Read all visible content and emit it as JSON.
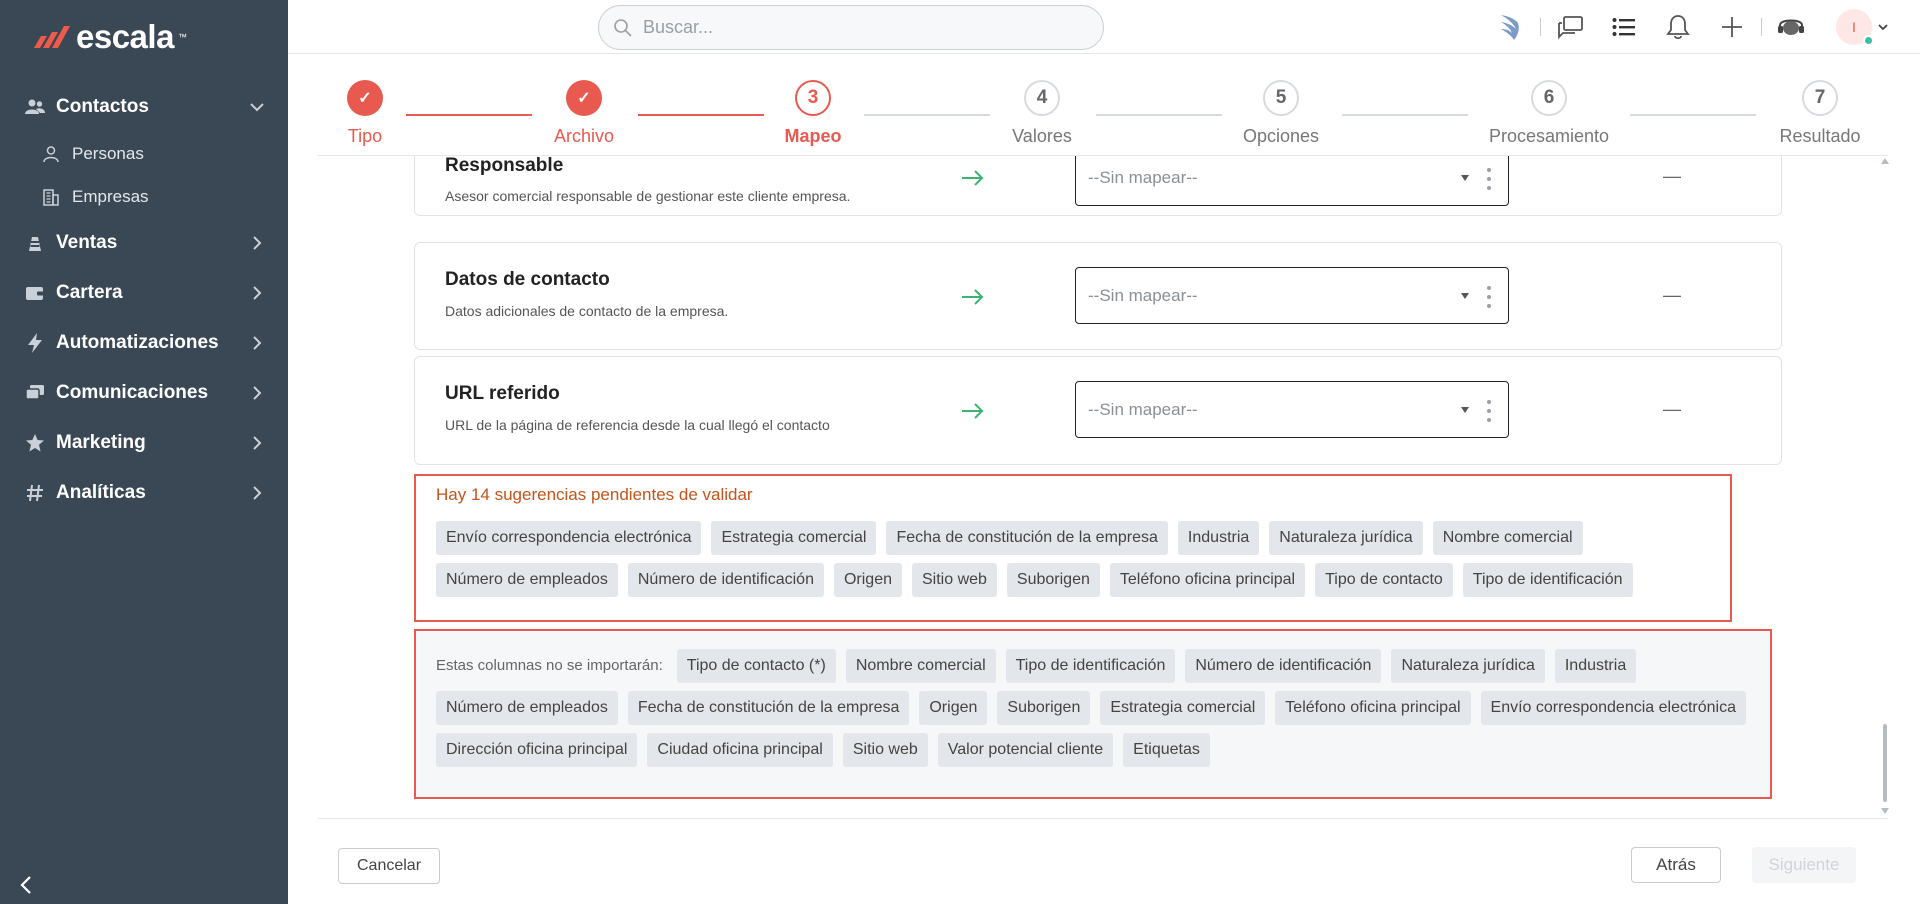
{
  "app": {
    "logo_text": "escala",
    "logo_tm": "™"
  },
  "sidebar": {
    "items": [
      {
        "label": "Contactos",
        "icon": "users-icon",
        "expanded": true,
        "children": [
          {
            "label": "Personas",
            "icon": "person-icon"
          },
          {
            "label": "Empresas",
            "icon": "building-icon"
          }
        ]
      },
      {
        "label": "Ventas",
        "icon": "ventas-icon"
      },
      {
        "label": "Cartera",
        "icon": "wallet-icon"
      },
      {
        "label": "Automatizaciones",
        "icon": "bolt-icon"
      },
      {
        "label": "Comunicaciones",
        "icon": "chat-icon"
      },
      {
        "label": "Marketing",
        "icon": "star-icon"
      },
      {
        "label": "Analíticas",
        "icon": "hash-icon"
      }
    ]
  },
  "header": {
    "search_placeholder": "Buscar...",
    "avatar_initial": "I"
  },
  "stepper": {
    "steps": [
      {
        "num": "1",
        "label": "Tipo",
        "state": "done"
      },
      {
        "num": "2",
        "label": "Archivo",
        "state": "done"
      },
      {
        "num": "3",
        "label": "Mapeo",
        "state": "active"
      },
      {
        "num": "4",
        "label": "Valores",
        "state": "todo"
      },
      {
        "num": "5",
        "label": "Opciones",
        "state": "todo"
      },
      {
        "num": "6",
        "label": "Procesamiento",
        "state": "todo"
      },
      {
        "num": "7",
        "label": "Resultado",
        "state": "todo"
      }
    ]
  },
  "fields": [
    {
      "title": "Responsable",
      "description": "Asesor comercial responsable de gestionar este cliente empresa.",
      "select_value": "--Sin mapear--",
      "preview": "—"
    },
    {
      "title": "Datos de contacto",
      "description": "Datos adicionales de contacto de la empresa.",
      "select_value": "--Sin mapear--",
      "preview": "—"
    },
    {
      "title": "URL referido",
      "description": "URL de la página de referencia desde la cual llegó el contacto",
      "select_value": "--Sin mapear--",
      "preview": "—"
    }
  ],
  "suggestions": {
    "title": "Hay 14 sugerencias pendientes de validar",
    "chips": [
      "Envío correspondencia electrónica",
      "Estrategia comercial",
      "Fecha de constitución de la empresa",
      "Industria",
      "Naturaleza jurídica",
      "Nombre comercial",
      "Número de empleados",
      "Número de identificación",
      "Origen",
      "Sitio web",
      "Suborigen",
      "Teléfono oficina principal",
      "Tipo de contacto",
      "Tipo de identificación"
    ]
  },
  "ignored": {
    "label": "Estas columnas no se importarán:",
    "chips": [
      "Tipo de contacto (*)",
      "Nombre comercial",
      "Tipo de identificación",
      "Número de identificación",
      "Naturaleza jurídica",
      "Industria",
      "Número de empleados",
      "Fecha de constitución de la empresa",
      "Origen",
      "Suborigen",
      "Estrategia comercial",
      "Teléfono oficina principal",
      "Envío correspondencia electrónica",
      "Dirección oficina principal",
      "Ciudad oficina principal",
      "Sitio web",
      "Valor potencial cliente",
      "Etiquetas"
    ]
  },
  "footer": {
    "cancel_label": "Cancelar",
    "back_label": "Atrás",
    "next_label": "Siguiente"
  },
  "colors": {
    "accent": "#e85a4f",
    "sidebar_bg": "#3a4754",
    "arrow_green": "#3cb371"
  }
}
